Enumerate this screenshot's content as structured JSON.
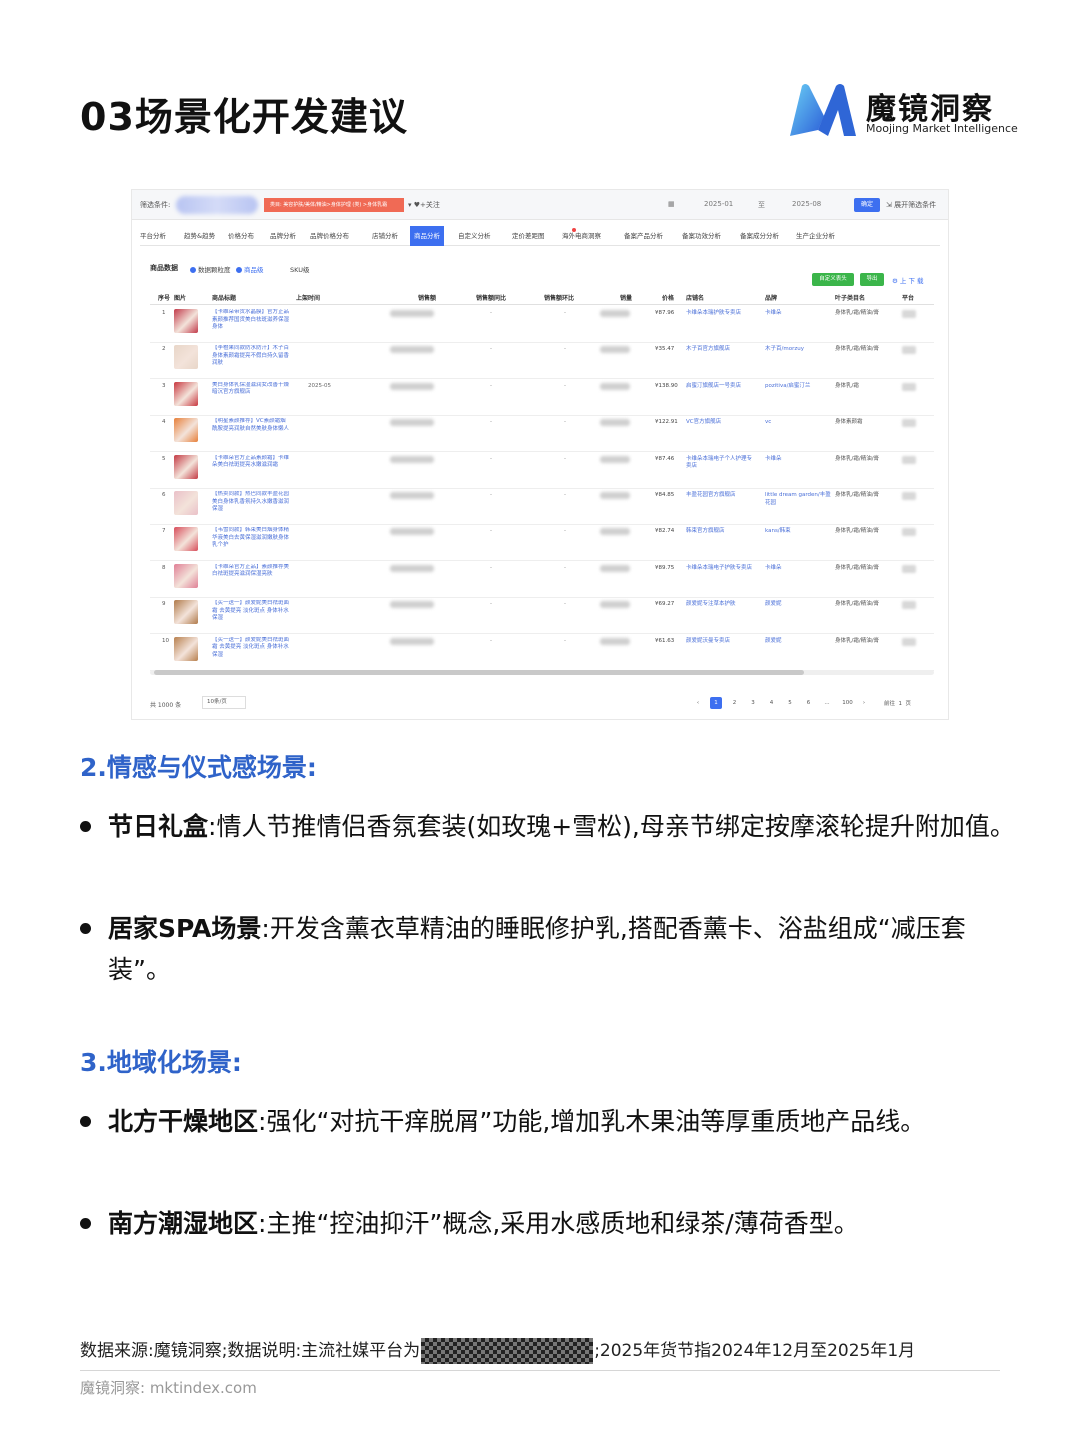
{
  "header": {
    "title": "03场景化开发建议",
    "logo_cn": "魔镜洞察",
    "logo_en": "Moojing Market Intelligence"
  },
  "screenshot": {
    "filter_label": "筛选条件:",
    "filter_chip": "类目: 美容护肤/美体/精油>身体护理 (类) >身体乳霜",
    "follow": "+关注",
    "date_from": "2025-01",
    "date_to_label": "至",
    "date_to": "2025-08",
    "confirm_label": "确定",
    "expand_label": "展开筛选条件",
    "tabs": [
      "平台分析",
      "趋势&趋势",
      "价格分布",
      "品牌分析",
      "品牌价格分布",
      "店铺分析",
      "商品分析",
      "自定义分析",
      "定价差距图",
      "海外电商洞察",
      "备案产品分析",
      "备案功效分析",
      "备案成分分析",
      "生产企业分析"
    ],
    "active_tab": 6,
    "section_title": "商品数据",
    "radio_options": [
      "数据颗粒度",
      "商品级",
      "SKU级"
    ],
    "btn_custom": "自定义表头",
    "btn_export": "导出",
    "download": "上 下 载",
    "columns": [
      "序号",
      "图片",
      "商品标题",
      "上架时间",
      "销售额",
      "销售额同比",
      "销售额环比",
      "销量",
      "价格",
      "店铺名",
      "品牌",
      "叶子类目名",
      "平台"
    ],
    "rows": [
      {
        "idx": "1",
        "title": "【卡维朵带货水晶膜】官方正品素颜推荐国货美白祛斑滋养保湿身体",
        "date": "",
        "price": "¥87.96",
        "store": "卡维朵本瑞护肤专卖店",
        "brand": "卡维朵",
        "cat": "身体乳/霜/精油/膏",
        "color": "#c23a4a"
      },
      {
        "idx": "2",
        "title": "【李橙果同款防水防汗】木子百身体素颜霜提亮不假白持久留香润肤",
        "date": "",
        "price": "¥35.47",
        "store": "木子百官方旗舰店",
        "brand": "木子百/morzuy",
        "cat": "身体乳/霜/精油/膏",
        "color": "#e8d6c8"
      },
      {
        "idx": "3",
        "title": "美白身体乳保湿滋润女改善干燥暗沉官方旗舰店",
        "date": "2025-05",
        "price": "¥138.90",
        "store": "启蜜汀旗舰店一号卖店",
        "brand": "pozitiva/启蜜汀兰",
        "cat": "身体乳/霜",
        "color": "#c8373f"
      },
      {
        "idx": "4",
        "title": "【明星素颜推荐】VC素颜霜烟酰胺提亮润肤自然美肤身体懒人",
        "date": "",
        "price": "¥122.91",
        "store": "VC官方旗舰店",
        "brand": "vc",
        "cat": "身体素颜霜",
        "color": "#e7803a"
      },
      {
        "idx": "5",
        "title": "【卡维朵官方正品素颜霜】卡维朵美白祛斑提亮水嫩滋润霜",
        "date": "",
        "price": "¥87.46",
        "store": "卡维朵本瑞电子个人护理专卖店",
        "brand": "卡维朵",
        "cat": "身体乳/霜/精油/膏",
        "color": "#c43a44"
      },
      {
        "idx": "6",
        "title": "【热卖同款】热巴同款丰盈花园美白身体乳香氛持久水嫩香滋润保湿",
        "date": "",
        "price": "¥84.85",
        "store": "丰盈花园官方旗舰店",
        "brand": "little dream garden/丰盈花园",
        "cat": "身体乳/霜/精油/膏",
        "color": "#eac0c8"
      },
      {
        "idx": "7",
        "title": "【韦雪同款】韩束美白烟身体精华液美白去黄保湿滋润嫩肤身体乳个护",
        "date": "",
        "price": "¥82.74",
        "store": "韩束官方旗舰店",
        "brand": "kans/韩束",
        "cat": "身体乳/霜/精油/膏",
        "color": "#d84d5a"
      },
      {
        "idx": "8",
        "title": "【卡维朵官方正品】素颜推荐美白祛斑提亮滋润保湿亮肤",
        "date": "",
        "price": "¥89.75",
        "store": "卡维朵本瑞电子护肤专卖店",
        "brand": "卡维朵",
        "cat": "身体乳/霜/精油/膏",
        "color": "#e07f95"
      },
      {
        "idx": "9",
        "title": "【买一送一】颜爱妮美白祛斑面霜 去黄提亮 淡化斑点 身体补水保湿",
        "date": "",
        "price": "¥69.27",
        "store": "颜爱妮专注草本护肤",
        "brand": "颜爱妮",
        "cat": "身体乳/霜/精油/膏",
        "color": "#b07a4a"
      },
      {
        "idx": "10",
        "title": "【买一送一】颜爱妮美白祛斑面霜 去黄提亮 淡化斑点 身体补水保湿",
        "date": "",
        "price": "¥61.63",
        "store": "颜爱妮沃曼专卖店",
        "brand": "颜爱妮",
        "cat": "身体乳/霜/精油/膏",
        "color": "#b8804e"
      }
    ],
    "total": "共 1000 条",
    "per_page": "10条/页",
    "pages": [
      "1",
      "2",
      "3",
      "4",
      "5",
      "6",
      "...",
      "100"
    ],
    "goto_label": "前往",
    "goto_value": "1",
    "goto_unit": "页"
  },
  "section2": {
    "heading": "2.情感与仪式感场景:",
    "items": [
      {
        "label": "节日礼盒",
        "text": ":情人节推情侣香氛套装(如玫瑰+雪松),母亲节绑定按摩滚轮提升附加值。"
      },
      {
        "label": "居家SPA场景",
        "text": ":开发含薰衣草精油的睡眠修护乳,搭配香薰卡、浴盐组成“减压套装”。"
      }
    ]
  },
  "section3": {
    "heading": "3.地域化场景:",
    "items": [
      {
        "label": "北方干燥地区",
        "text": ":强化“对抗干痒脱屑”功能,增加乳木果油等厚重质地产品线。"
      },
      {
        "label": "南方潮湿地区",
        "text": ":主推“控油抑汗”概念,采用水感质地和绿茶/薄荷香型。"
      }
    ]
  },
  "footer": {
    "source_prefix": "数据来源:魔镜洞察;数据说明:主流社媒平台为",
    "source_suffix": ";2025年货节指2024年12月至2025年1月",
    "site": "魔镜洞察: mktindex.com"
  }
}
